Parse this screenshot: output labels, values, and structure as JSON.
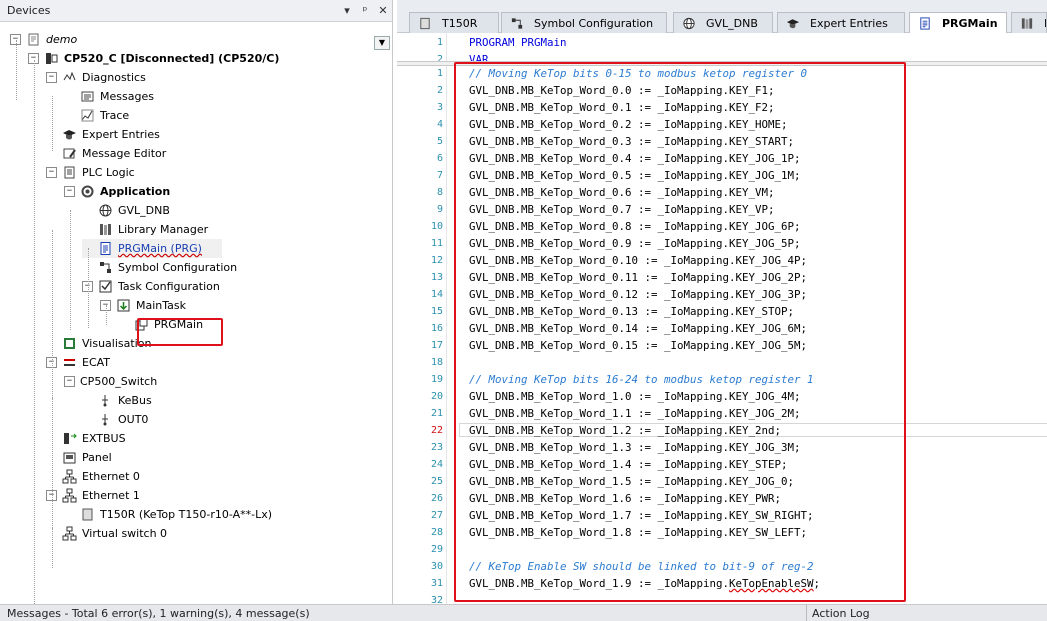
{
  "devices": {
    "title": "Devices",
    "header_buttons": [
      "▾",
      "ᵖ",
      "✕"
    ],
    "tree": [
      {
        "label": "demo",
        "level": 0,
        "toggle": "−",
        "icon": "project-icon",
        "style": "italic"
      },
      {
        "label": "CP520_C [Disconnected] (CP520/C)",
        "level": 1,
        "toggle": "−",
        "icon": "plc-device-icon",
        "style": "bold"
      },
      {
        "label": "Diagnostics",
        "level": 2,
        "toggle": "−",
        "icon": "diagnostics-icon"
      },
      {
        "label": "Messages",
        "level": 3,
        "toggle": "",
        "icon": "messages-icon"
      },
      {
        "label": "Trace",
        "level": 3,
        "toggle": "",
        "icon": "trace-icon"
      },
      {
        "label": "Expert Entries",
        "level": 2,
        "toggle": "",
        "icon": "expert-entries-icon"
      },
      {
        "label": "Message Editor",
        "level": 2,
        "toggle": "",
        "icon": "message-editor-icon"
      },
      {
        "label": "PLC Logic",
        "level": 2,
        "toggle": "−",
        "icon": "plc-logic-icon"
      },
      {
        "label": "Application",
        "level": 3,
        "toggle": "−",
        "icon": "application-icon",
        "style": "bold"
      },
      {
        "label": "GVL_DNB",
        "level": 4,
        "toggle": "",
        "icon": "globe-icon"
      },
      {
        "label": "Library Manager",
        "level": 4,
        "toggle": "",
        "icon": "library-icon"
      },
      {
        "label": "PRGMain (PRG)",
        "level": 4,
        "toggle": "",
        "icon": "program-icon",
        "style": "link"
      },
      {
        "label": "Symbol Configuration",
        "level": 4,
        "toggle": "",
        "icon": "symbol-config-icon"
      },
      {
        "label": "Task Configuration",
        "level": 4,
        "toggle": "−",
        "icon": "task-config-icon"
      },
      {
        "label": "MainTask",
        "level": 5,
        "toggle": "−",
        "icon": "task-icon"
      },
      {
        "label": "PRGMain",
        "level": 6,
        "toggle": "",
        "icon": "program-call-icon"
      },
      {
        "label": "Visualisation",
        "level": 2,
        "toggle": "",
        "icon": "visualisation-icon"
      },
      {
        "label": "ECAT",
        "level": 2,
        "toggle": "−",
        "icon": "ecat-icon"
      },
      {
        "label": "CP500_Switch",
        "level": 3,
        "toggle": "−",
        "icon": ""
      },
      {
        "label": "KeBus",
        "level": 4,
        "toggle": "",
        "icon": "kebus-icon"
      },
      {
        "label": "OUT0",
        "level": 4,
        "toggle": "",
        "icon": "out-icon"
      },
      {
        "label": "EXTBUS",
        "level": 2,
        "toggle": "",
        "icon": "extbus-icon"
      },
      {
        "label": "Panel",
        "level": 2,
        "toggle": "",
        "icon": "panel-icon"
      },
      {
        "label": "Ethernet 0",
        "level": 2,
        "toggle": "",
        "icon": "network-icon"
      },
      {
        "label": "Ethernet 1",
        "level": 2,
        "toggle": "−",
        "icon": "network-icon"
      },
      {
        "label": "T150R (KeTop T150-r10-A**-Lx)",
        "level": 3,
        "toggle": "",
        "icon": "device-icon"
      },
      {
        "label": "Virtual switch 0",
        "level": 2,
        "toggle": "",
        "icon": "network-icon"
      }
    ]
  },
  "tabs": [
    {
      "label": "T150R",
      "icon": "device-icon",
      "active": false
    },
    {
      "label": "Symbol Configuration",
      "icon": "symbol-config-icon",
      "active": false
    },
    {
      "label": "GVL_DNB",
      "icon": "globe-icon",
      "active": false
    },
    {
      "label": "Expert Entries",
      "icon": "expert-entries-icon",
      "active": false
    },
    {
      "label": "PRGMain",
      "icon": "program-icon",
      "active": true,
      "close": "✕"
    },
    {
      "label": "L",
      "icon": "library-icon",
      "active": false
    }
  ],
  "declaration": [
    {
      "num": "1",
      "text": "PROGRAM PRGMain"
    },
    {
      "num": "2",
      "text": "VAR"
    }
  ],
  "code_lines": [
    {
      "num": "1",
      "text": "// Moving KeTop bits 0-15 to modbus ketop register 0",
      "type": "comment"
    },
    {
      "num": "2",
      "text": "GVL_DNB.MB_KeTop_Word_0.0 := _IoMapping.KEY_F1;"
    },
    {
      "num": "3",
      "text": "GVL_DNB.MB_KeTop_Word_0.1 := _IoMapping.KEY_F2;"
    },
    {
      "num": "4",
      "text": "GVL_DNB.MB_KeTop_Word_0.2 := _IoMapping.KEY_HOME;"
    },
    {
      "num": "5",
      "text": "GVL_DNB.MB_KeTop_Word_0.3 := _IoMapping.KEY_START;"
    },
    {
      "num": "6",
      "text": "GVL_DNB.MB_KeTop_Word_0.4 := _IoMapping.KEY_JOG_1P;"
    },
    {
      "num": "7",
      "text": "GVL_DNB.MB_KeTop_Word_0.5 := _IoMapping.KEY_JOG_1M;"
    },
    {
      "num": "8",
      "text": "GVL_DNB.MB_KeTop_Word_0.6 := _IoMapping.KEY_VM;"
    },
    {
      "num": "9",
      "text": "GVL_DNB.MB_KeTop_Word_0.7 := _IoMapping.KEY_VP;"
    },
    {
      "num": "10",
      "text": "GVL_DNB.MB_KeTop_Word_0.8 := _IoMapping.KEY_JOG_6P;"
    },
    {
      "num": "11",
      "text": "GVL_DNB.MB_KeTop_Word_0.9 := _IoMapping.KEY_JOG_5P;"
    },
    {
      "num": "12",
      "text": "GVL_DNB.MB_KeTop_Word_0.10 := _IoMapping.KEY_JOG_4P;"
    },
    {
      "num": "13",
      "text": "GVL_DNB.MB_KeTop_Word_0.11 := _IoMapping.KEY_JOG_2P;"
    },
    {
      "num": "14",
      "text": "GVL_DNB.MB_KeTop_Word_0.12 := _IoMapping.KEY_JOG_3P;"
    },
    {
      "num": "15",
      "text": "GVL_DNB.MB_KeTop_Word_0.13 := _IoMapping.KEY_STOP;"
    },
    {
      "num": "16",
      "text": "GVL_DNB.MB_KeTop_Word_0.14 := _IoMapping.KEY_JOG_6M;"
    },
    {
      "num": "17",
      "text": "GVL_DNB.MB_KeTop_Word_0.15 := _IoMapping.KEY_JOG_5M;"
    },
    {
      "num": "18",
      "text": ""
    },
    {
      "num": "19",
      "text": "// Moving KeTop bits 16-24 to modbus ketop register 1",
      "type": "comment"
    },
    {
      "num": "20",
      "text": "GVL_DNB.MB_KeTop_Word_1.0 := _IoMapping.KEY_JOG_4M;"
    },
    {
      "num": "21",
      "text": "GVL_DNB.MB_KeTop_Word_1.1 := _IoMapping.KEY_JOG_2M;"
    },
    {
      "num": "22",
      "text": "GVL_DNB.MB_KeTop_Word_1.2 := _IoMapping.KEY_2nd;",
      "current": true
    },
    {
      "num": "23",
      "text": "GVL_DNB.MB_KeTop_Word_1.3 := _IoMapping.KEY_JOG_3M;"
    },
    {
      "num": "24",
      "text": "GVL_DNB.MB_KeTop_Word_1.4 := _IoMapping.KEY_STEP;"
    },
    {
      "num": "25",
      "text": "GVL_DNB.MB_KeTop_Word_1.5 := _IoMapping.KEY_JOG_0;"
    },
    {
      "num": "26",
      "text": "GVL_DNB.MB_KeTop_Word_1.6 := _IoMapping.KEY_PWR;"
    },
    {
      "num": "27",
      "text": "GVL_DNB.MB_KeTop_Word_1.7 := _IoMapping.KEY_SW_RIGHT;"
    },
    {
      "num": "28",
      "text": "GVL_DNB.MB_KeTop_Word_1.8 := _IoMapping.KEY_SW_LEFT;"
    },
    {
      "num": "29",
      "text": ""
    },
    {
      "num": "30",
      "text": "// KeTop Enable SW should be linked to bit-9 of reg-2",
      "type": "comment"
    },
    {
      "num": "31",
      "text": "GVL_DNB.MB_KeTop_Word_1.9 := _IoMapping.KeTopEnableSW;",
      "squiggle": "KeTopEnableSW"
    },
    {
      "num": "32",
      "text": ""
    }
  ],
  "bottom": {
    "messages": "Messages - Total 6 error(s), 1 warning(s), 4 message(s)",
    "action_log": "Action Log"
  },
  "colors": {
    "highlight_box": "#e0101a",
    "keyword": "#0000e0",
    "comment": "#2b7bd1",
    "line_number": "#2b91af"
  }
}
